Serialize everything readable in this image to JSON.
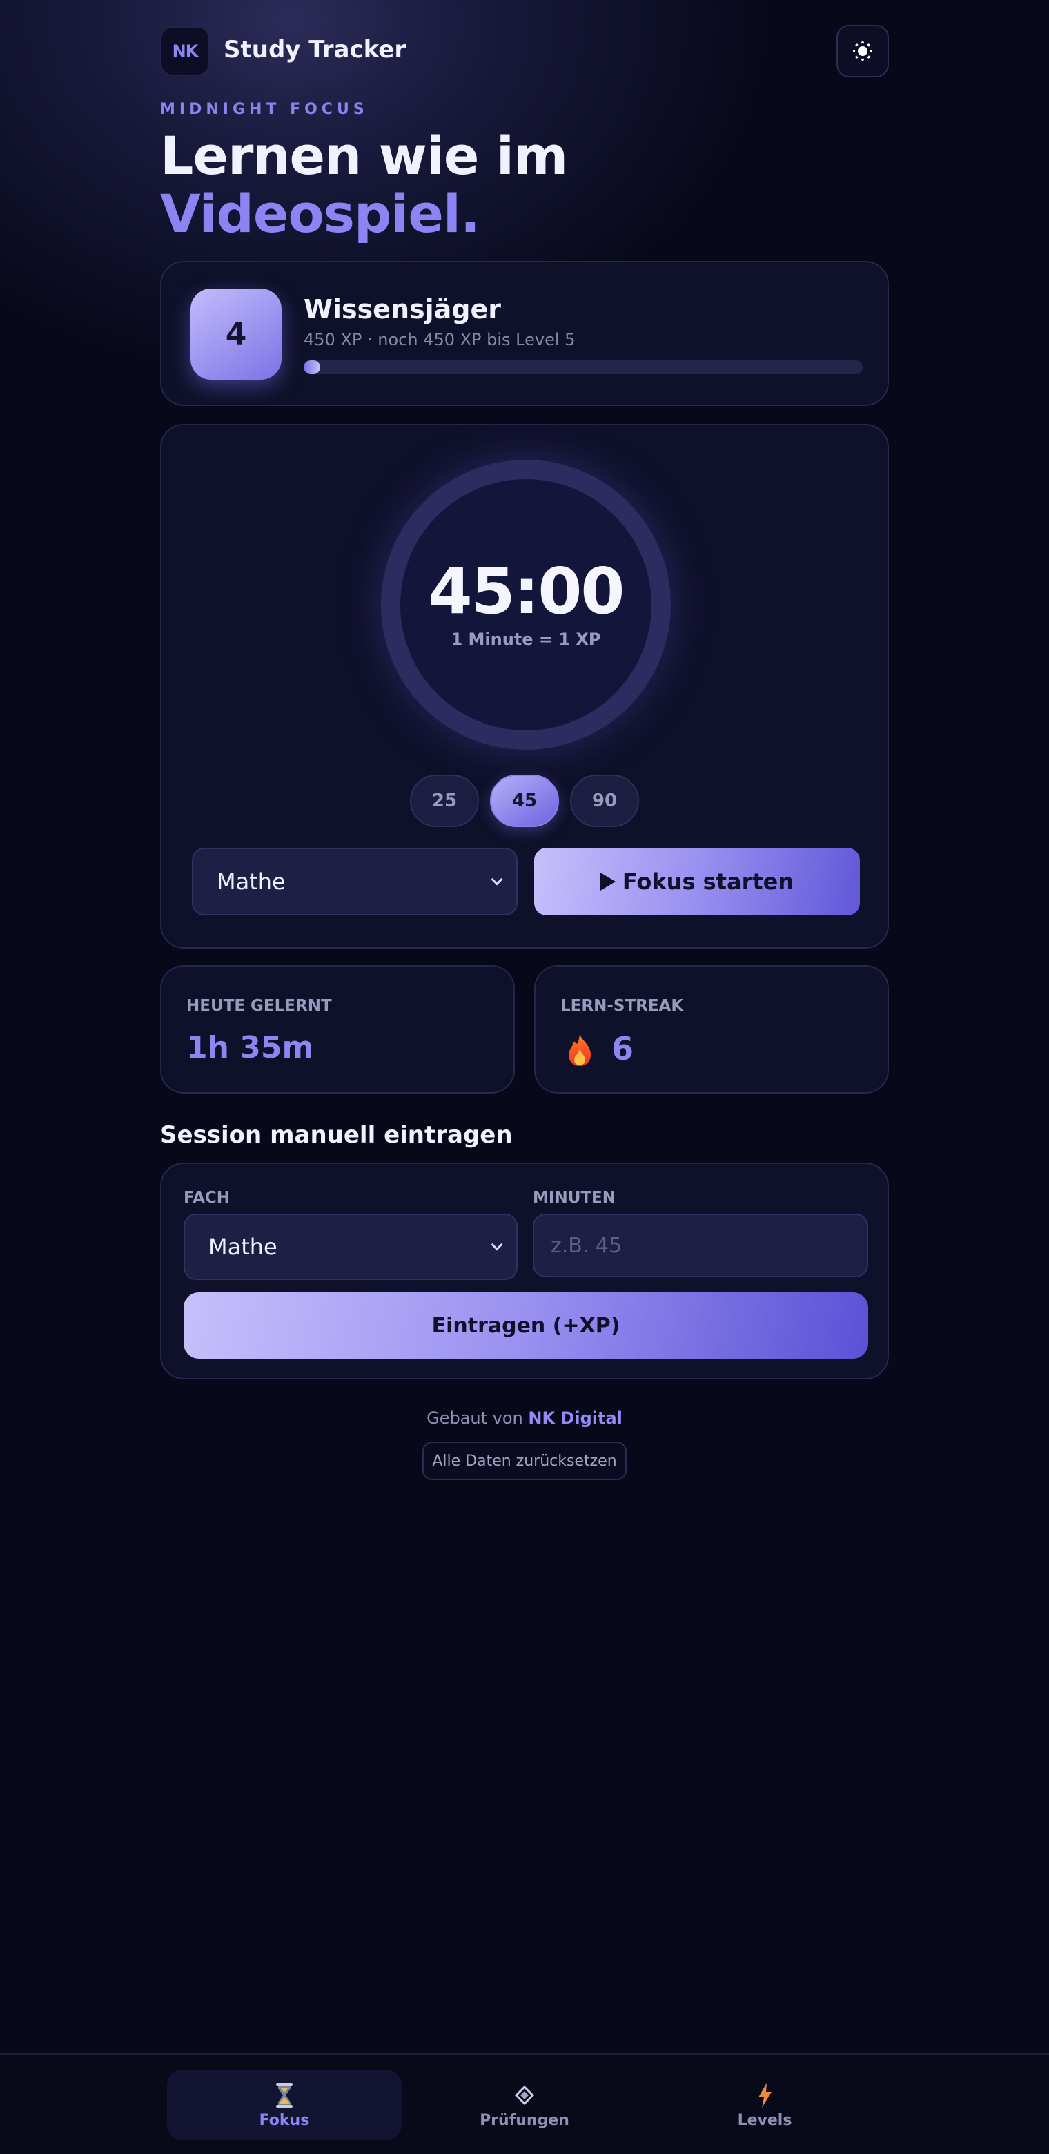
{
  "header": {
    "logo_text": "NK",
    "app_title": "Study Tracker",
    "theme_toggle_icon": "sun-icon"
  },
  "hero": {
    "eyebrow": "MIDNIGHT FOCUS",
    "headline_line1": "Lernen wie im",
    "headline_line2": "Videospiel."
  },
  "level_card": {
    "level": "4",
    "rank_name": "Wissensjäger",
    "progress_text": "450 XP · noch 450 XP bis Level 5",
    "progress_fraction": 0.03
  },
  "timer": {
    "time": "45:00",
    "rate_note": "1 Minute = 1 XP",
    "presets": [
      "25",
      "45",
      "90"
    ],
    "active_preset": "45",
    "subject": "Mathe",
    "start_label": "Fokus starten"
  },
  "stats": {
    "today_label": "HEUTE GELERNT",
    "today_value": "1h 35m",
    "streak_label": "LERN-STREAK",
    "streak_value": "6",
    "streak_icon": "flame-icon"
  },
  "manual_entry": {
    "title": "Session manuell eintragen",
    "subject_label": "FACH",
    "subject_value": "Mathe",
    "minutes_label": "MINUTEN",
    "minutes_placeholder": "z.B. 45",
    "submit_label": "Eintragen (+XP)"
  },
  "footer": {
    "credit_prefix": "Gebaut von",
    "credit_brand": "NK Digital",
    "reset_label": "Alle Daten zurücksetzen"
  },
  "nav": {
    "items": [
      {
        "label": "Fokus",
        "icon": "hourglass-icon",
        "active": true
      },
      {
        "label": "Prüfungen",
        "icon": "diamond-icon",
        "active": false
      },
      {
        "label": "Levels",
        "icon": "lightning-icon",
        "active": false
      }
    ]
  },
  "colors": {
    "background": "#07081a",
    "accent": "#8e85f3",
    "card": "#0f1029"
  }
}
